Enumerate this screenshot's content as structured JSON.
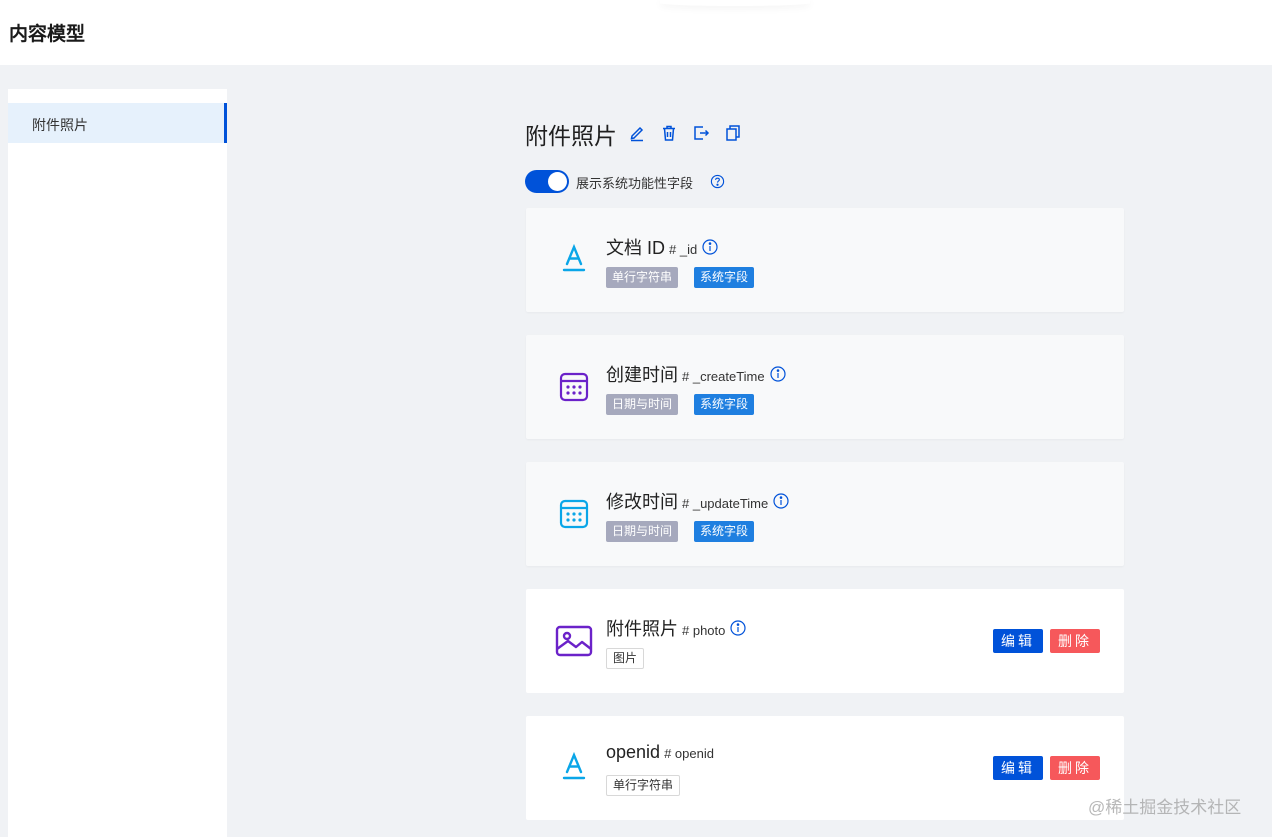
{
  "header": {
    "title": "内容模型"
  },
  "sidebar": {
    "items": [
      {
        "label": "附件照片"
      }
    ]
  },
  "model": {
    "title": "附件照片"
  },
  "toggle": {
    "label": "展示系统功能性字段",
    "on": true
  },
  "fields": [
    {
      "name": "文档 ID",
      "id": "# _id",
      "icon": "text-type-icon",
      "tags": [
        "单行字符串",
        "系统字段"
      ]
    },
    {
      "name": "创建时间",
      "id": "# _createTime",
      "icon": "calendar-icon",
      "tags": [
        "日期与时间",
        "系统字段"
      ]
    },
    {
      "name": "修改时间",
      "id": "# _updateTime",
      "icon": "calendar-icon",
      "tags": [
        "日期与时间",
        "系统字段"
      ]
    },
    {
      "name": "附件照片",
      "id": "# photo",
      "icon": "image-icon",
      "tags": [
        "图片"
      ],
      "edit": "编辑",
      "delete": "删除"
    },
    {
      "name": "openid",
      "id": "# openid",
      "icon": "text-type-icon",
      "tags": [
        "单行字符串"
      ],
      "edit": "编辑",
      "delete": "删除"
    }
  ],
  "watermark": "@稀土掘金技术社区",
  "colors": {
    "primary": "#0052d9",
    "danger": "#f6585b",
    "tag_gray": "#a6a9bd",
    "tag_blue": "#1f7fe0",
    "icon_cyan": "#0aa6e8",
    "icon_purple": "#6b22c9"
  }
}
